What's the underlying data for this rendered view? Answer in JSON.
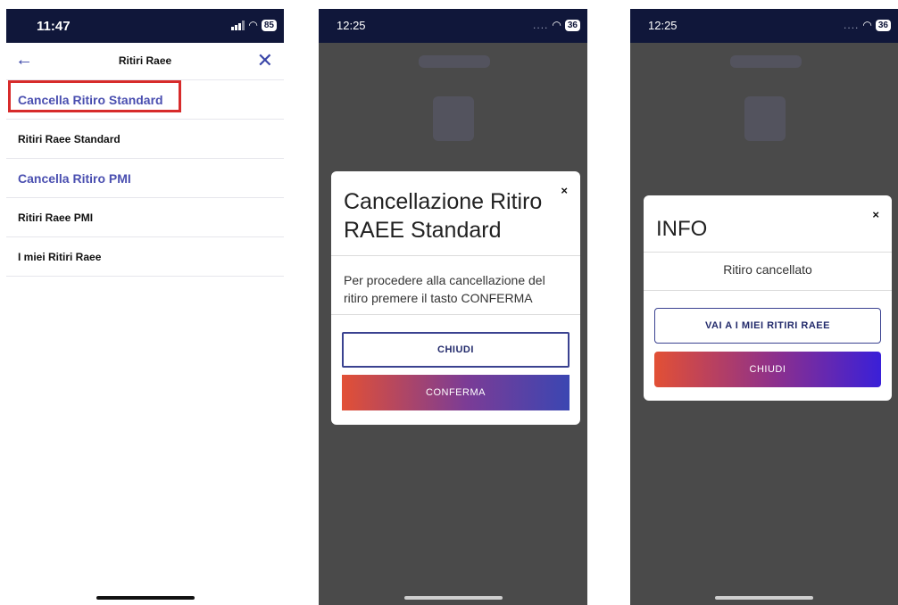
{
  "screens": [
    {
      "status": {
        "time": "11:47",
        "battery": "85"
      },
      "header": {
        "title": "Ritiri Raee",
        "back_icon": "arrow-left-icon",
        "close_icon": "close-icon"
      },
      "menu": [
        {
          "label": "Cancella Ritiro Standard"
        },
        {
          "label": "Ritiri Raee Standard"
        },
        {
          "label": "Cancella Ritiro PMI"
        },
        {
          "label": "Ritiri Raee PMI"
        },
        {
          "label": "I miei Ritiri Raee"
        }
      ]
    },
    {
      "status": {
        "time": "12:25",
        "battery": "36",
        "dots": "...."
      },
      "dialog": {
        "title": "Cancellazione Ritiro RAEE Standard",
        "close": "×",
        "message": "Per procedere alla cancellazione del ritiro premere il tasto CONFERMA",
        "secondary_button": "CHIUDI",
        "primary_button": "CONFERMA"
      }
    },
    {
      "status": {
        "time": "12:25",
        "battery": "36",
        "dots": "...."
      },
      "dialog": {
        "title": "INFO",
        "close": "×",
        "message": "Ritiro cancellato",
        "secondary_button": "VAI A I MIEI RITIRI RAEE",
        "primary_button": "CHIUDI"
      }
    }
  ],
  "colors": {
    "status_bar": "#10173a",
    "accent_blue": "#4a4fb0",
    "highlight_red": "#d72b2b",
    "gradient_start": "#e25035",
    "gradient_end": "#3b46b2"
  }
}
